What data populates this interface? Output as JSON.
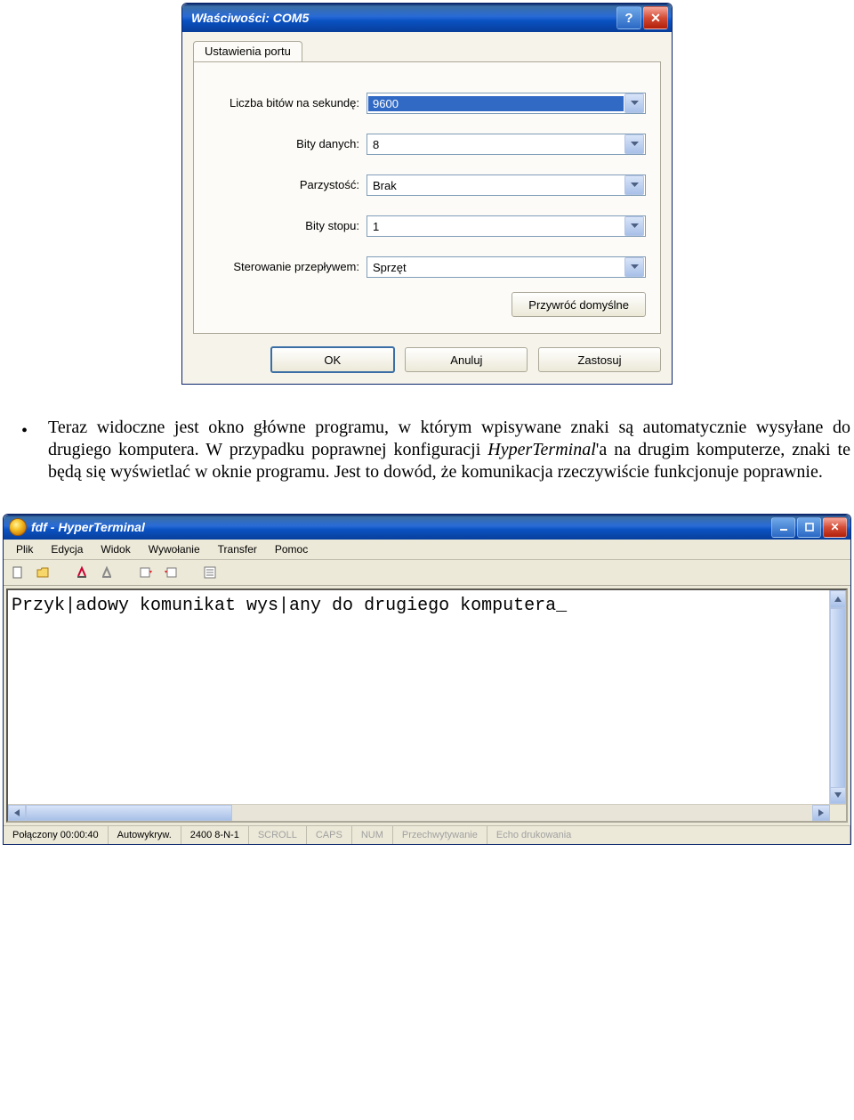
{
  "dialog": {
    "title": "Właściwości: COM5",
    "tab": "Ustawienia portu",
    "fields": {
      "baud": {
        "label": "Liczba bitów na sekundę:",
        "value": "9600"
      },
      "data": {
        "label": "Bity danych:",
        "value": "8"
      },
      "parity": {
        "label": "Parzystość:",
        "value": "Brak"
      },
      "stop": {
        "label": "Bity stopu:",
        "value": "1"
      },
      "flow": {
        "label": "Sterowanie przepływem:",
        "value": "Sprzęt"
      }
    },
    "restore_btn": "Przywróć domyślne",
    "ok_btn": "OK",
    "cancel_btn": "Anuluj",
    "apply_btn": "Zastosuj"
  },
  "paragraph": {
    "part1": "Teraz widoczne jest okno główne programu, w którym wpisywane znaki są automatycznie wysyłane do drugiego komputera. W przypadku poprawnej konfiguracji ",
    "ital": "HyperTerminal",
    "part2": "'a na drugim komputerze, znaki te będą się wyświetlać w oknie programu. Jest to dowód, że komunikacja rzeczywiście funkcjonuje poprawnie."
  },
  "ht": {
    "title": "fdf - HyperTerminal",
    "menu": {
      "file": "Plik",
      "edit": "Edycja",
      "view": "Widok",
      "call": "Wywołanie",
      "transfer": "Transfer",
      "help": "Pomoc"
    },
    "terminal_text": "Przyk|adowy komunikat wys|any do drugiego komputera_",
    "status": {
      "conn": "Połączony 00:00:40",
      "auto": "Autowykryw.",
      "proto": "2400 8-N-1",
      "scroll": "SCROLL",
      "caps": "CAPS",
      "num": "NUM",
      "capture": "Przechwytywanie",
      "echo": "Echo drukowania"
    }
  }
}
